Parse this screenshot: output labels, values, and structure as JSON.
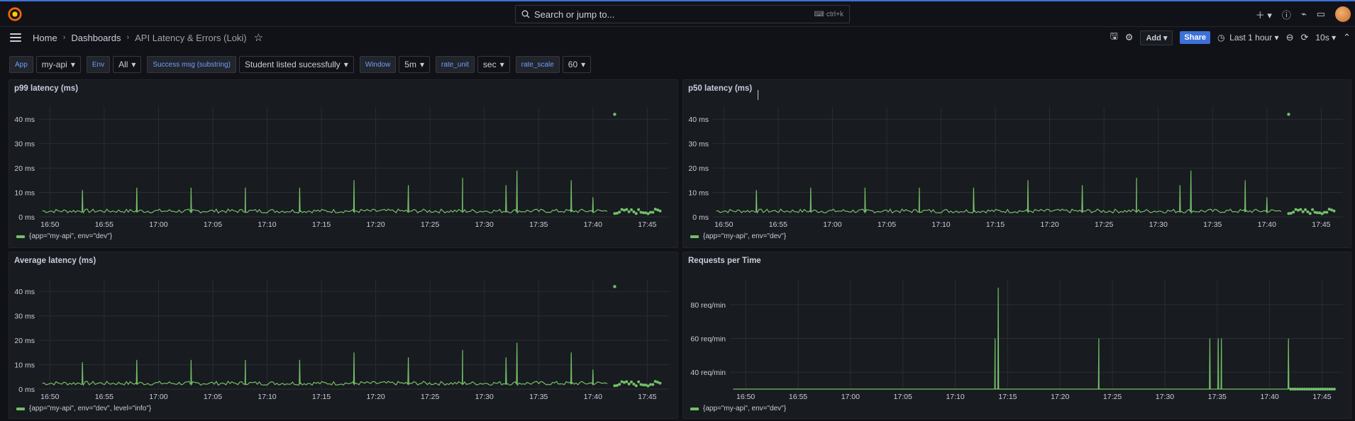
{
  "search": {
    "placeholder": "Search or jump to...",
    "shortcut": "ctrl+k"
  },
  "breadcrumb": {
    "home": "Home",
    "dashboards": "Dashboards",
    "current": "API Latency & Errors (Loki)"
  },
  "toolbar": {
    "add_label": "Add",
    "share_label": "Share",
    "time_range": "Last 1 hour",
    "refresh": "10s"
  },
  "variables": [
    {
      "label": "App",
      "value": "my-api"
    },
    {
      "label": "Env",
      "value": "All"
    },
    {
      "label": "Success msg (substring)",
      "value": "Student listed sucessfully"
    },
    {
      "label": "Window",
      "value": "5m"
    },
    {
      "label": "rate_unit",
      "value": "sec"
    },
    {
      "label": "rate_scale",
      "value": "60"
    }
  ],
  "colors": {
    "series": "#73bf69",
    "accent": "#3d71d9",
    "label": "#6e9fff"
  },
  "panels": [
    {
      "title": "p99 latency (ms)",
      "legend": "{app=\"my-api\", env=\"dev\"}"
    },
    {
      "title": "p50 latency (ms)",
      "legend": "{app=\"my-api\", env=\"dev\"}"
    },
    {
      "title": "Average latency (ms)",
      "legend": "{app=\"my-api\", env=\"dev\", level=\"info\"}"
    },
    {
      "title": "Requests per Time",
      "legend": "{app=\"my-api\", env=\"dev\"}"
    }
  ],
  "chart_data": [
    {
      "type": "line",
      "title": "p99 latency (ms)",
      "x_ticks": [
        "16:50",
        "16:55",
        "17:00",
        "17:05",
        "17:10",
        "17:15",
        "17:20",
        "17:25",
        "17:30",
        "17:35",
        "17:40",
        "17:45"
      ],
      "y_ticks": [
        "0 ms",
        "10 ms",
        "20 ms",
        "30 ms",
        "40 ms"
      ],
      "ylim": [
        0,
        45
      ],
      "series": [
        {
          "name": "{app=\"my-api\", env=\"dev\"}",
          "spikes": [
            [
              "16:53",
              11
            ],
            [
              "16:58",
              12
            ],
            [
              "17:03",
              12
            ],
            [
              "17:08",
              12
            ],
            [
              "17:13",
              12
            ],
            [
              "17:18",
              15
            ],
            [
              "17:23",
              13
            ],
            [
              "17:28",
              16
            ],
            [
              "17:32",
              13
            ],
            [
              "17:33",
              19
            ],
            [
              "17:38",
              15
            ],
            [
              "17:40",
              8
            ],
            [
              "17:42",
              42
            ]
          ],
          "baseline": 2
        }
      ]
    },
    {
      "type": "line",
      "title": "p50 latency (ms)",
      "x_ticks": [
        "16:50",
        "16:55",
        "17:00",
        "17:05",
        "17:10",
        "17:15",
        "17:20",
        "17:25",
        "17:30",
        "17:35",
        "17:40",
        "17:45"
      ],
      "y_ticks": [
        "0 ms",
        "10 ms",
        "20 ms",
        "30 ms",
        "40 ms"
      ],
      "ylim": [
        0,
        45
      ],
      "series": [
        {
          "name": "{app=\"my-api\", env=\"dev\"}",
          "spikes": [
            [
              "16:53",
              11
            ],
            [
              "16:58",
              12
            ],
            [
              "17:03",
              12
            ],
            [
              "17:08",
              12
            ],
            [
              "17:13",
              12
            ],
            [
              "17:18",
              15
            ],
            [
              "17:23",
              13
            ],
            [
              "17:28",
              16
            ],
            [
              "17:32",
              13
            ],
            [
              "17:33",
              19
            ],
            [
              "17:38",
              15
            ],
            [
              "17:40",
              8
            ],
            [
              "17:42",
              42
            ]
          ],
          "baseline": 2
        }
      ]
    },
    {
      "type": "line",
      "title": "Average latency (ms)",
      "x_ticks": [
        "16:50",
        "16:55",
        "17:00",
        "17:05",
        "17:10",
        "17:15",
        "17:20",
        "17:25",
        "17:30",
        "17:35",
        "17:40",
        "17:45"
      ],
      "y_ticks": [
        "0 ms",
        "10 ms",
        "20 ms",
        "30 ms",
        "40 ms"
      ],
      "ylim": [
        0,
        45
      ],
      "series": [
        {
          "name": "{app=\"my-api\", env=\"dev\", level=\"info\"}",
          "spikes": [
            [
              "16:53",
              11
            ],
            [
              "16:58",
              12
            ],
            [
              "17:03",
              12
            ],
            [
              "17:08",
              12
            ],
            [
              "17:13",
              12
            ],
            [
              "17:18",
              15
            ],
            [
              "17:23",
              13
            ],
            [
              "17:28",
              16
            ],
            [
              "17:32",
              13
            ],
            [
              "17:33",
              19
            ],
            [
              "17:38",
              15
            ],
            [
              "17:40",
              8
            ],
            [
              "17:42",
              42
            ]
          ],
          "baseline": 2
        }
      ]
    },
    {
      "type": "line",
      "title": "Requests per Time",
      "x_ticks": [
        "16:50",
        "16:55",
        "17:00",
        "17:05",
        "17:10",
        "17:15",
        "17:20",
        "17:25",
        "17:30",
        "17:35",
        "17:40",
        "17:45"
      ],
      "y_ticks": [
        "40 req/min",
        "60 req/min",
        "80 req/min"
      ],
      "ylim": [
        30,
        95
      ],
      "series": [
        {
          "name": "{app=\"my-api\", env=\"dev\"}",
          "spikes": [
            [
              "17:13.8",
              60
            ],
            [
              "17:14.1",
              90
            ],
            [
              "17:23.7",
              60
            ],
            [
              "17:34.3",
              60
            ],
            [
              "17:35.1",
              60
            ],
            [
              "17:35.4",
              60
            ],
            [
              "17:41.8",
              60
            ]
          ],
          "baseline": 30
        }
      ]
    }
  ]
}
